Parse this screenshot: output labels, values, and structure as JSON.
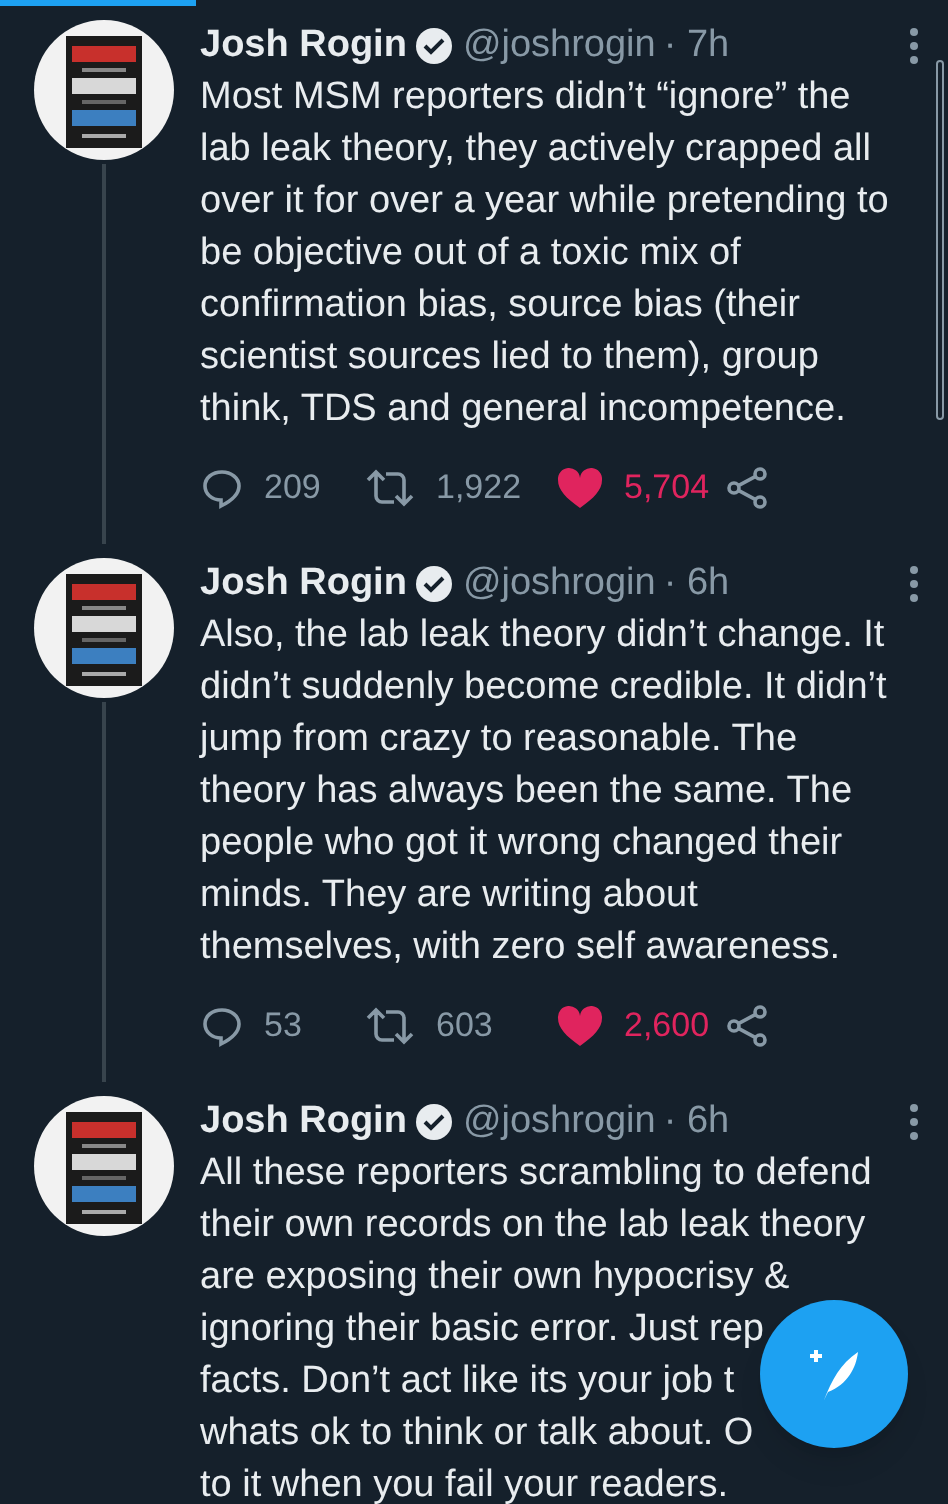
{
  "tweets": [
    {
      "name": "Josh Rogin",
      "verified": true,
      "handle": "@joshrogin",
      "time": "· 7h",
      "thread_below": true,
      "lines": [
        [
          "Most MSM reporters didn’t “ignore” the"
        ],
        [
          "lab leak theory, they actively crapped all"
        ],
        [
          "over it for over a year while pretending to"
        ],
        [
          "be objective out of a toxic mix of"
        ],
        [
          "confirmation bias, source bias (their"
        ],
        [
          "scientist sources lied to them), group"
        ],
        [
          "think, TDS and general incompetence."
        ]
      ],
      "actions": {
        "replies": "209",
        "retweets": "1,922",
        "likes": "5,704",
        "liked": true
      }
    },
    {
      "name": "Josh Rogin",
      "verified": true,
      "handle": "@joshrogin",
      "time": "· 6h",
      "thread_below": true,
      "lines": [
        [
          "Also, the lab leak theory didn’t change. It"
        ],
        [
          "didn’t suddenly become credible. It didn’t"
        ],
        [
          "jump from crazy to reasonable. The"
        ],
        [
          "theory has always been the same. The"
        ],
        [
          "people who got it wrong changed their"
        ],
        [
          "minds. They are writing about"
        ],
        [
          "themselves, with zero self awareness."
        ]
      ],
      "actions": {
        "replies": "53",
        "retweets": "603",
        "likes": "2,600",
        "liked": true
      }
    },
    {
      "name": "Josh Rogin",
      "verified": true,
      "handle": "@joshrogin",
      "time": "· 6h",
      "thread_below": false,
      "lines": [
        [
          "All these reporters scrambling to defend"
        ],
        [
          "their own records on the lab leak theory"
        ],
        [
          "are exposing their own hypocrisy &"
        ],
        [
          "ignoring their basic error. Just rep"
        ],
        [
          "facts. Don’t act like its your job t"
        ],
        [
          "whats ok to think or talk about. O"
        ],
        [
          "to it when you fail your readers."
        ]
      ]
    }
  ]
}
